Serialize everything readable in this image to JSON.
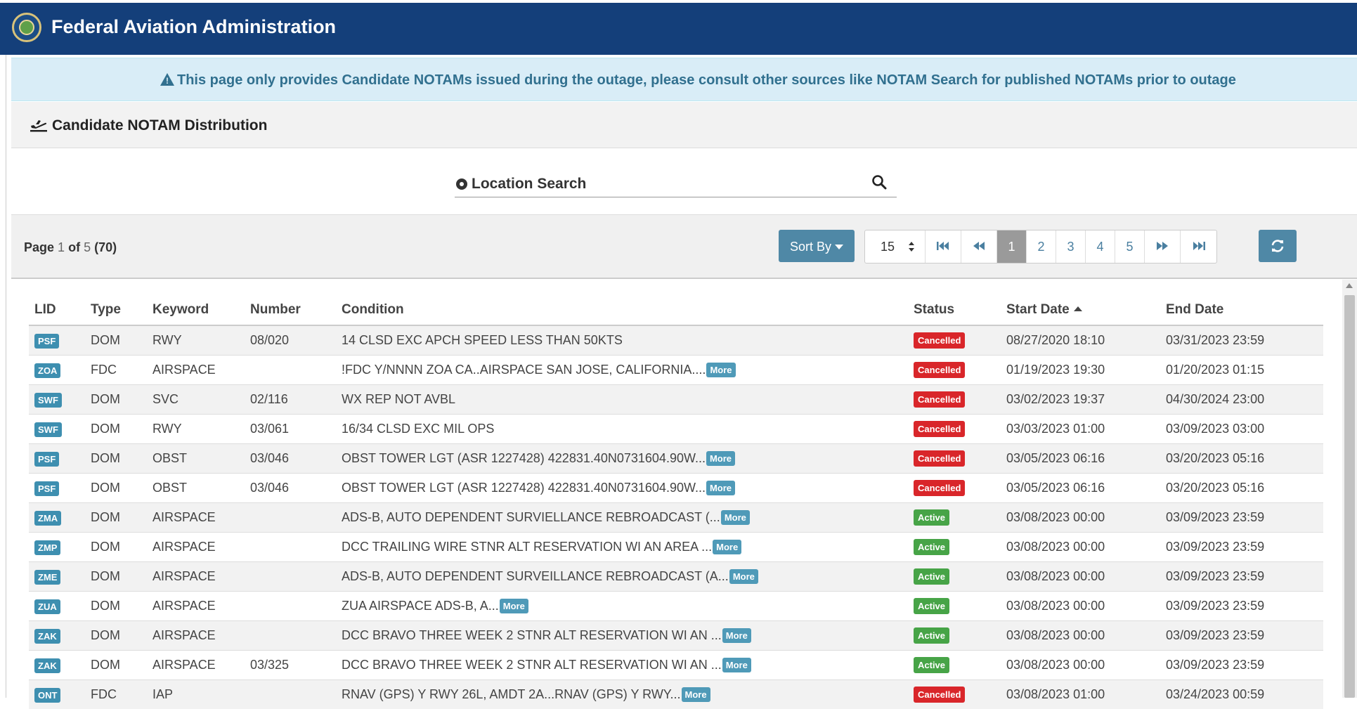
{
  "header": {
    "title": "Federal Aviation Administration",
    "logo": "faa-seal-icon"
  },
  "alert": {
    "text": "This page only provides Candidate NOTAMs issued during the outage, please consult other sources like NOTAM Search for published NOTAMs prior to outage",
    "icon": "warning-icon"
  },
  "panel": {
    "title": "Candidate NOTAM Distribution",
    "icon": "plane-departure-icon"
  },
  "search": {
    "label": "Location Search"
  },
  "toolbar": {
    "page_label": "Page",
    "page_current": "1",
    "page_of": "of",
    "page_total": "5",
    "record_count": "(70)",
    "sort_label": "Sort By",
    "page_size": "15",
    "pages": [
      "1",
      "2",
      "3",
      "4",
      "5"
    ],
    "active_page": "1"
  },
  "table": {
    "columns": [
      "LID",
      "Type",
      "Keyword",
      "Number",
      "Condition",
      "Status",
      "Start Date",
      "End Date"
    ],
    "more_label": "More",
    "rows": [
      {
        "lid": "PSF",
        "type": "DOM",
        "keyword": "RWY",
        "number": "08/020",
        "condition": "14 CLSD EXC APCH SPEED LESS THAN 50KTS",
        "more": false,
        "status": "Cancelled",
        "start": "08/27/2020 18:10",
        "end": "03/31/2023 23:59"
      },
      {
        "lid": "ZOA",
        "type": "FDC",
        "keyword": "AIRSPACE",
        "number": "",
        "condition": "!FDC Y/NNNN ZOA CA..AIRSPACE SAN JOSE, CALIFORNIA....",
        "more": true,
        "status": "Cancelled",
        "start": "01/19/2023 19:30",
        "end": "01/20/2023 01:15"
      },
      {
        "lid": "SWF",
        "type": "DOM",
        "keyword": "SVC",
        "number": "02/116",
        "condition": "WX REP NOT AVBL",
        "more": false,
        "status": "Cancelled",
        "start": "03/02/2023 19:37",
        "end": "04/30/2024 23:00"
      },
      {
        "lid": "SWF",
        "type": "DOM",
        "keyword": "RWY",
        "number": "03/061",
        "condition": "16/34 CLSD EXC MIL OPS",
        "more": false,
        "status": "Cancelled",
        "start": "03/03/2023 01:00",
        "end": "03/09/2023 03:00"
      },
      {
        "lid": "PSF",
        "type": "DOM",
        "keyword": "OBST",
        "number": "03/046",
        "condition": "OBST TOWER LGT (ASR 1227428) 422831.40N0731604.90W...",
        "more": true,
        "status": "Cancelled",
        "start": "03/05/2023 06:16",
        "end": "03/20/2023 05:16"
      },
      {
        "lid": "PSF",
        "type": "DOM",
        "keyword": "OBST",
        "number": "03/046",
        "condition": "OBST TOWER LGT (ASR 1227428) 422831.40N0731604.90W...",
        "more": true,
        "status": "Cancelled",
        "start": "03/05/2023 06:16",
        "end": "03/20/2023 05:16"
      },
      {
        "lid": "ZMA",
        "type": "DOM",
        "keyword": "AIRSPACE",
        "number": "",
        "condition": "ADS-B, AUTO DEPENDENT SURVIELLANCE REBROADCAST (...",
        "more": true,
        "status": "Active",
        "start": "03/08/2023 00:00",
        "end": "03/09/2023 23:59"
      },
      {
        "lid": "ZMP",
        "type": "DOM",
        "keyword": "AIRSPACE",
        "number": "",
        "condition": "DCC TRAILING WIRE STNR ALT RESERVATION WI AN AREA ...",
        "more": true,
        "status": "Active",
        "start": "03/08/2023 00:00",
        "end": "03/09/2023 23:59"
      },
      {
        "lid": "ZME",
        "type": "DOM",
        "keyword": "AIRSPACE",
        "number": "",
        "condition": "ADS-B, AUTO DEPENDENT SURVEILLANCE REBROADCAST (A...",
        "more": true,
        "status": "Active",
        "start": "03/08/2023 00:00",
        "end": "03/09/2023 23:59"
      },
      {
        "lid": "ZUA",
        "type": "DOM",
        "keyword": "AIRSPACE",
        "number": "",
        "condition": "ZUA AIRSPACE ADS-B, A...",
        "more": true,
        "status": "Active",
        "start": "03/08/2023 00:00",
        "end": "03/09/2023 23:59"
      },
      {
        "lid": "ZAK",
        "type": "DOM",
        "keyword": "AIRSPACE",
        "number": "",
        "condition": "DCC BRAVO THREE WEEK 2 STNR ALT RESERVATION WI AN ...",
        "more": true,
        "status": "Active",
        "start": "03/08/2023 00:00",
        "end": "03/09/2023 23:59"
      },
      {
        "lid": "ZAK",
        "type": "DOM",
        "keyword": "AIRSPACE",
        "number": "03/325",
        "condition": "DCC BRAVO THREE WEEK 2 STNR ALT RESERVATION WI AN ...",
        "more": true,
        "status": "Active",
        "start": "03/08/2023 00:00",
        "end": "03/09/2023 23:59"
      },
      {
        "lid": "ONT",
        "type": "FDC",
        "keyword": "IAP",
        "number": "",
        "condition": "RNAV (GPS) Y RWY 26L, AMDT 2A...RNAV (GPS) Y RWY...",
        "more": true,
        "status": "Cancelled",
        "start": "03/08/2023 01:00",
        "end": "03/24/2023 00:59"
      }
    ]
  }
}
